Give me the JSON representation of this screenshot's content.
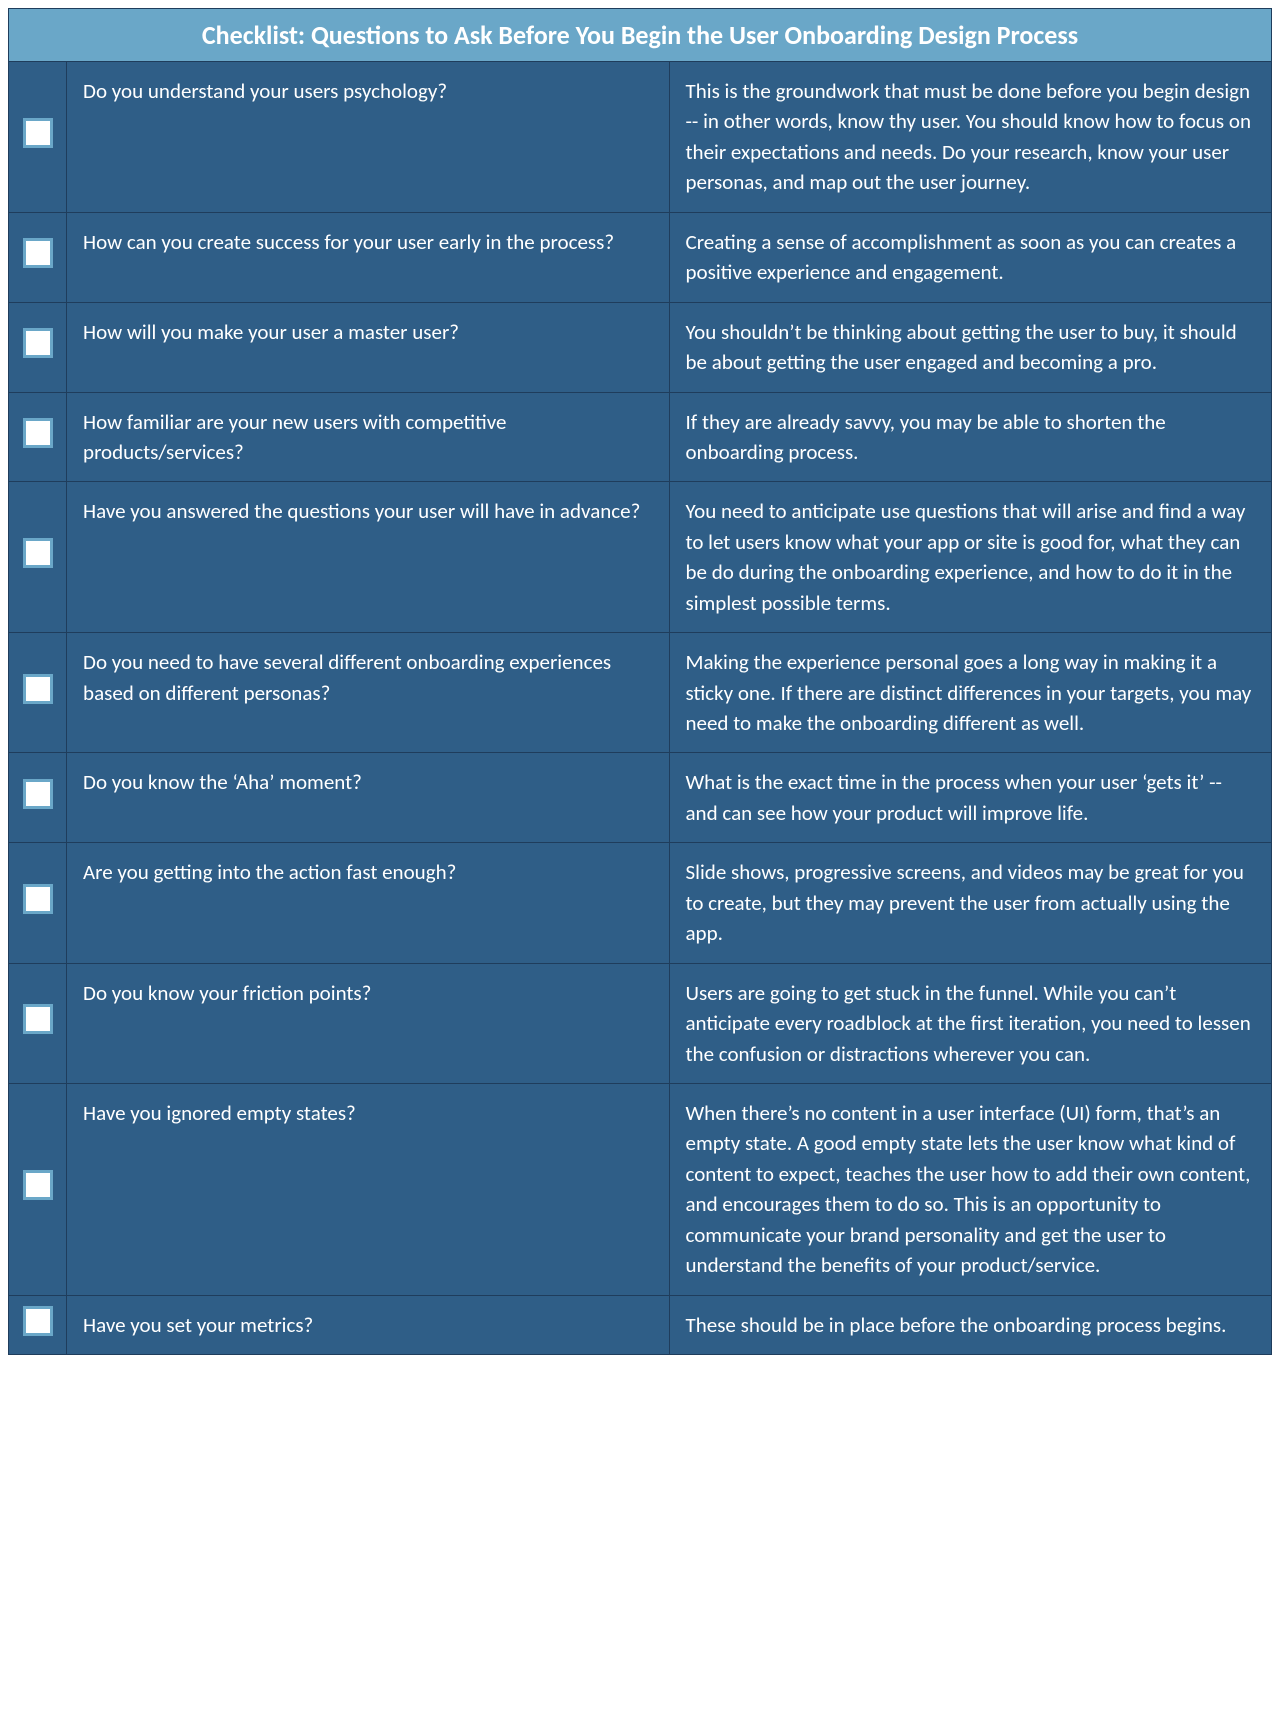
{
  "title": "Checklist: Questions to Ask Before You Begin the User Onboarding Design Process",
  "rows": [
    {
      "question": "Do you understand your users psychology?",
      "answer": "This is the groundwork that must be done before you begin design -- in other words, know thy user. You should know how to focus on their expectations and needs. Do your research, know your user personas, and map out the user journey."
    },
    {
      "question": "How can you create success for your user early in the process?",
      "answer": "Creating a sense of accomplishment as soon as you can creates a positive experience and engagement."
    },
    {
      "question": "How will you make your user a master user?",
      "answer": "You shouldn’t be thinking about getting the user to buy, it should be about getting the user engaged and becoming a pro."
    },
    {
      "question": "How familiar are your new users with competitive products/services?",
      "answer": "If they are already savvy, you may be able to shorten the onboarding process."
    },
    {
      "question": "Have you answered the questions your user will have in advance?",
      "answer": "You need to anticipate use questions that will arise and find a way to let users know what your app or site is good for, what they can be do during the onboarding experience, and how to do it in the simplest possible terms."
    },
    {
      "question": "Do you need to have several different onboarding experiences based on different personas?",
      "answer": "Making the experience personal goes a long way in making it a sticky one. If there are distinct differences in your targets, you may need to make the onboarding different as well."
    },
    {
      "question": "Do you know the ‘Aha’ moment?",
      "answer": "What is the exact time in the process when your user ‘gets it’ -- and can see how  your product will improve life."
    },
    {
      "question": "Are you getting into the action fast enough?",
      "answer": "Slide shows, progressive screens, and videos may be great for you to create, but they may prevent the user from actually using the app."
    },
    {
      "question": "Do you know your friction points?",
      "answer": "Users are going to get stuck in the funnel. While you can’t anticipate every roadblock at the first iteration, you need to lessen the confusion or distractions wherever you can."
    },
    {
      "question": "Have you ignored empty states?",
      "answer": "When there’s no content in a user interface (UI) form, that’s an empty state. A good empty state lets the user know what kind of content to expect, teaches the user how to add their own content, and encourages them to do so. This is an opportunity to communicate your brand personality and get the user to understand the benefits of your product/service."
    },
    {
      "question": "Have you set your metrics?",
      "answer": "These should be in place before the onboarding process begins."
    }
  ]
}
